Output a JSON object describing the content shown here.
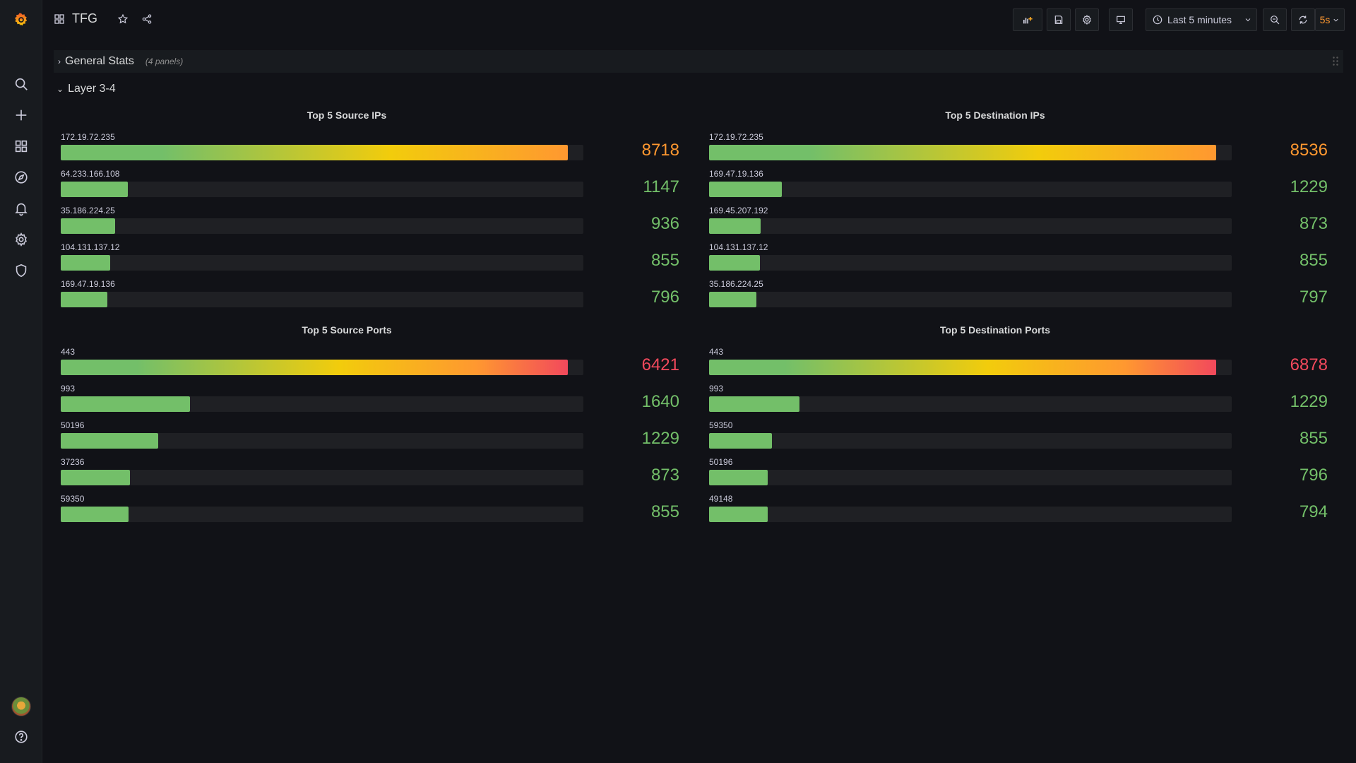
{
  "topbar": {
    "title": "TFG",
    "time_range": "Last 5 minutes",
    "refresh_interval": "5s"
  },
  "rows": {
    "general": {
      "label": "General Stats",
      "count": "(4 panels)"
    },
    "layer": {
      "label": "Layer 3-4"
    }
  },
  "panels": [
    {
      "title": "Top 5 Source IPs",
      "max": 8718,
      "items": [
        {
          "label": "172.19.72.235",
          "value": 8718,
          "color": "#ff9830"
        },
        {
          "label": "64.233.166.108",
          "value": 1147,
          "color": "#73bf69"
        },
        {
          "label": "35.186.224.25",
          "value": 936,
          "color": "#73bf69"
        },
        {
          "label": "104.131.137.12",
          "value": 855,
          "color": "#73bf69"
        },
        {
          "label": "169.47.19.136",
          "value": 796,
          "color": "#73bf69"
        }
      ]
    },
    {
      "title": "Top 5 Destination IPs",
      "max": 8536,
      "items": [
        {
          "label": "172.19.72.235",
          "value": 8536,
          "color": "#ff9830"
        },
        {
          "label": "169.47.19.136",
          "value": 1229,
          "color": "#73bf69"
        },
        {
          "label": "169.45.207.192",
          "value": 873,
          "color": "#73bf69"
        },
        {
          "label": "104.131.137.12",
          "value": 855,
          "color": "#73bf69"
        },
        {
          "label": "35.186.224.25",
          "value": 797,
          "color": "#73bf69"
        }
      ]
    },
    {
      "title": "Top 5 Source Ports",
      "max": 6421,
      "items": [
        {
          "label": "443",
          "value": 6421,
          "color": "#f2495c"
        },
        {
          "label": "993",
          "value": 1640,
          "color": "#73bf69"
        },
        {
          "label": "50196",
          "value": 1229,
          "color": "#73bf69"
        },
        {
          "label": "37236",
          "value": 873,
          "color": "#73bf69"
        },
        {
          "label": "59350",
          "value": 855,
          "color": "#73bf69"
        }
      ]
    },
    {
      "title": "Top 5 Destination Ports",
      "max": 6878,
      "items": [
        {
          "label": "443",
          "value": 6878,
          "color": "#f2495c"
        },
        {
          "label": "993",
          "value": 1229,
          "color": "#73bf69"
        },
        {
          "label": "59350",
          "value": 855,
          "color": "#73bf69"
        },
        {
          "label": "50196",
          "value": 796,
          "color": "#73bf69"
        },
        {
          "label": "49148",
          "value": 794,
          "color": "#73bf69"
        }
      ]
    }
  ],
  "colors": {
    "green": "#73bf69",
    "yellow": "#f2cc0c",
    "orange": "#ff9830",
    "red": "#f2495c"
  }
}
